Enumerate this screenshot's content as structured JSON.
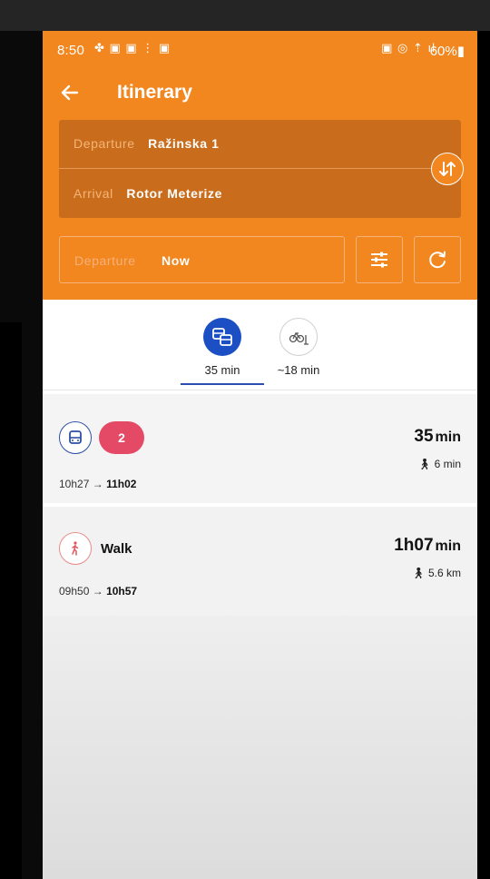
{
  "status_bar": {
    "time": "8:50",
    "battery": "60%"
  },
  "app_bar": {
    "title": "Itinerary",
    "back_icon": "arrow-left-icon"
  },
  "route": {
    "departure_label": "Departure",
    "departure_value": "Ražinska 1",
    "arrival_label": "Arrival",
    "arrival_value": "Rotor Meterize",
    "swap_icon": "swap-vertical-icon"
  },
  "time_selector": {
    "label": "Departure",
    "value": "Now",
    "filter_icon": "sliders-icon",
    "refresh_icon": "refresh-icon"
  },
  "modes": [
    {
      "icon": "transit-icon",
      "time": "35 min",
      "active": true
    },
    {
      "icon": "scooter-bike-icon",
      "time": "~18 min",
      "active": false
    }
  ],
  "results": [
    {
      "mode_icon": "bus-icon",
      "line": "2",
      "depart": "10h27",
      "arrow": "→",
      "arrive": "11h02",
      "duration_num": "35",
      "duration_unit": "min",
      "walk": "6 min"
    },
    {
      "mode_icon": "walk-icon",
      "label": "Walk",
      "depart": "09h50",
      "arrow": "→",
      "arrive": "10h57",
      "duration_num": "1h07",
      "duration_unit": "min",
      "walk": "5.6 km"
    }
  ],
  "colors": {
    "brand_orange": "#f2861f",
    "route_box": "#c96d1d",
    "active_mode": "#1c4fc4",
    "line_pill": "#e44a66"
  }
}
